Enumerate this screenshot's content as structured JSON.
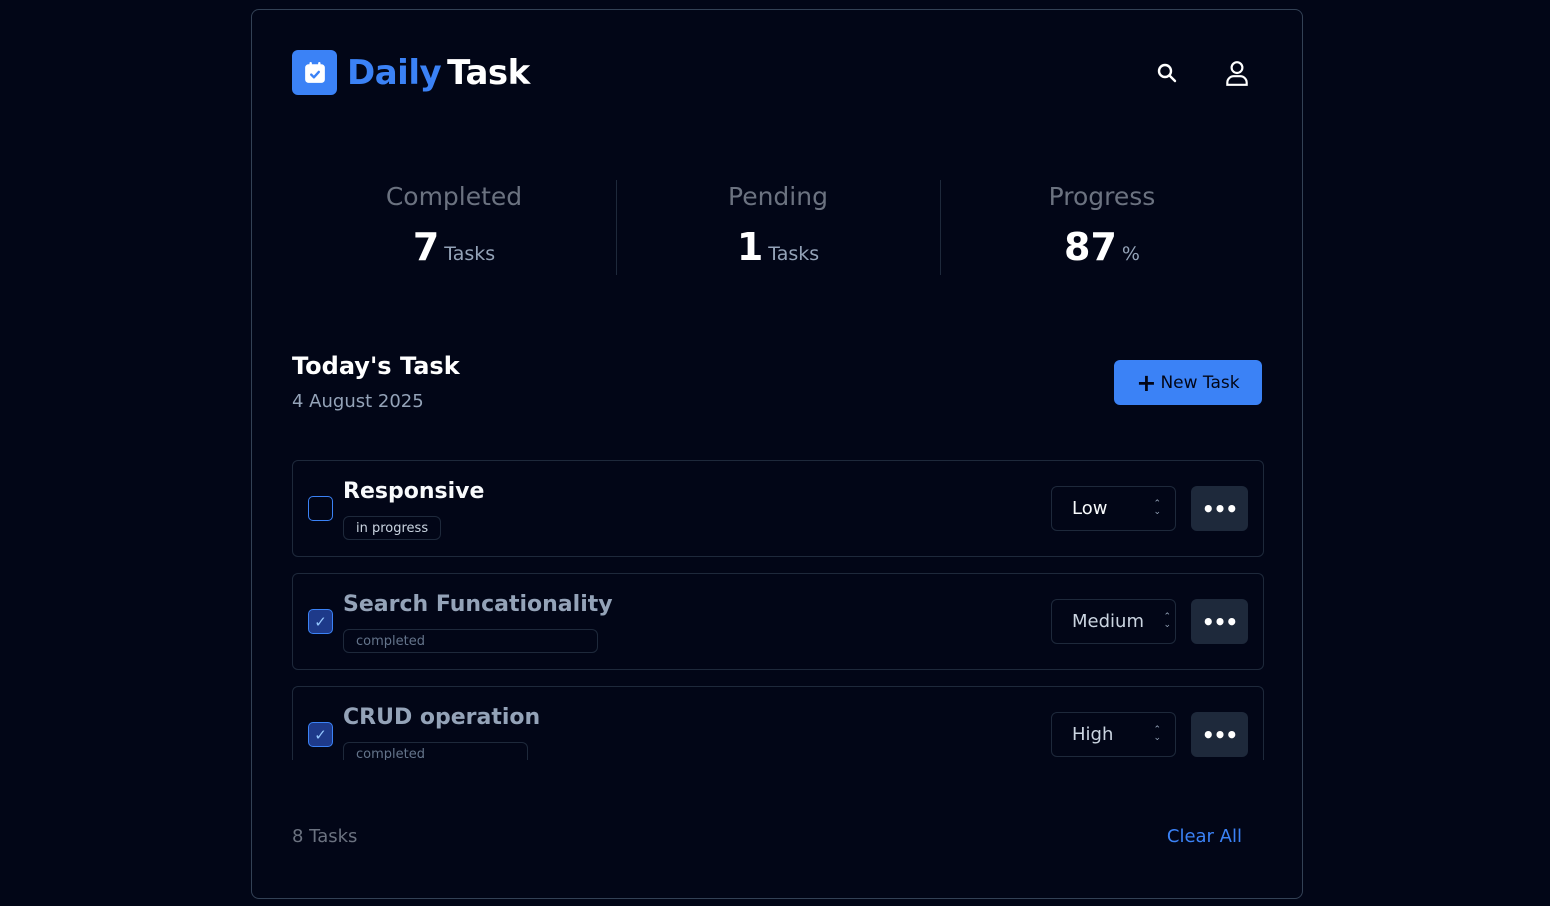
{
  "header": {
    "logo_word_1": "Daily",
    "logo_word_2": "Task",
    "logo_icon": "calendar-check-icon",
    "search_icon": "search-icon",
    "profile_icon": "user-icon"
  },
  "stats": [
    {
      "label": "Completed",
      "value": "7",
      "unit": "Tasks"
    },
    {
      "label": "Pending",
      "value": "1",
      "unit": "Tasks"
    },
    {
      "label": "Progress",
      "value": "87",
      "unit": "%"
    }
  ],
  "section": {
    "title": "Today's Task",
    "date": "4 August 2025",
    "new_task_label": "New Task",
    "new_task_icon": "plus-icon"
  },
  "tasks": [
    {
      "title": "Responsive",
      "status": "in progress",
      "priority": "Low",
      "checked": false
    },
    {
      "title": "Search Funcationality",
      "status": "completed",
      "priority": "Medium",
      "checked": true
    },
    {
      "title": "CRUD operation",
      "status": "completed",
      "priority": "High",
      "checked": true
    }
  ],
  "footer": {
    "count": "8 Tasks",
    "clear_label": "Clear All"
  },
  "colors": {
    "background": "#020617",
    "accent": "#3b82f6",
    "border": "#1e293b"
  }
}
